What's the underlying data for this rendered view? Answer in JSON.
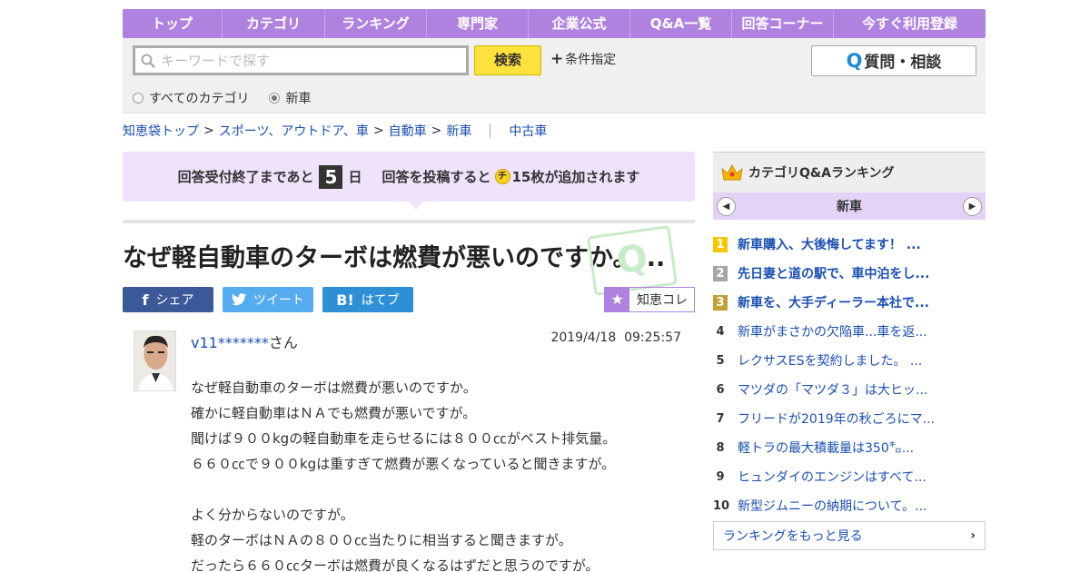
{
  "nav": [
    "トップ",
    "カテゴリ",
    "ランキング",
    "専門家",
    "企業公式",
    "Q&A一覧",
    "回答コーナー",
    "今すぐ利用登録"
  ],
  "search": {
    "placeholder": "キーワードで探す",
    "button": "検索",
    "conditions": "条件指定",
    "ask_button": "質問・相談",
    "scope_all": "すべてのカテゴリ",
    "scope_current": "新車",
    "selected_scope": "新車"
  },
  "breadcrumb": {
    "items": [
      "知恵袋トップ",
      "スポーツ、アウトドア、車",
      "自動車",
      "新車"
    ],
    "related": "中古車"
  },
  "notice": {
    "prefix": "回答受付終了まであと",
    "days": "5",
    "days_unit": "日",
    "middle": "回答を投稿すると",
    "coin": "チ",
    "suffix": "15枚が追加されます"
  },
  "question": {
    "title": "なぜ軽自動車のターボは燃費が悪いのですか。...",
    "user": "v11*******",
    "honorific": "さん",
    "date": "2019/4/18  09:25:57",
    "body": [
      "なぜ軽自動車のターボは燃費が悪いのですか。",
      "確かに軽自動車はＮＡでも燃費が悪いですが。",
      "聞けば９００kgの軽自動車を走らせるには８００㏄がベスト排気量。",
      "６６０㏄で９００kgは重すぎて燃費が悪くなっていると聞きますが。",
      "",
      "よく分からないのですが。",
      "軽のターボはＮＡの８００㏄当たりに相当すると聞きますが。",
      "だったら６６０㏄ターボは燃費が良くなるはずだと思うのですが。"
    ]
  },
  "share": {
    "facebook": "シェア",
    "twitter": "ツイート",
    "hatena": "はてブ",
    "chiekore": "知恵コレ"
  },
  "sidebar": {
    "title": "カテゴリQ&Aランキング",
    "category": "新車",
    "ranking": [
      {
        "rank": "1",
        "title": "新車購入、大後悔してます！ ..."
      },
      {
        "rank": "2",
        "title": "先日妻と道の駅で、車中泊をし..."
      },
      {
        "rank": "3",
        "title": "新車を、大手ディーラー本社で..."
      },
      {
        "rank": "4",
        "title": "新車がまさかの欠陥車...車を返..."
      },
      {
        "rank": "5",
        "title": "レクサスESを契約しました。 ..."
      },
      {
        "rank": "6",
        "title": "マツダの「マツダ３」は大ヒッ..."
      },
      {
        "rank": "7",
        "title": "フリードが2019年の秋ごろにマ..."
      },
      {
        "rank": "8",
        "title": "軽トラの最大積載量は350㌔..."
      },
      {
        "rank": "9",
        "title": "ヒュンダイのエンジンはすべて..."
      },
      {
        "rank": "10",
        "title": "新型ジムニーの納期について。..."
      }
    ],
    "more": "ランキングをもっと見る"
  },
  "colors": {
    "brand_purple": "#b082e0",
    "search_yellow": "#ffe23b",
    "link_blue": "#1a4fb4"
  }
}
